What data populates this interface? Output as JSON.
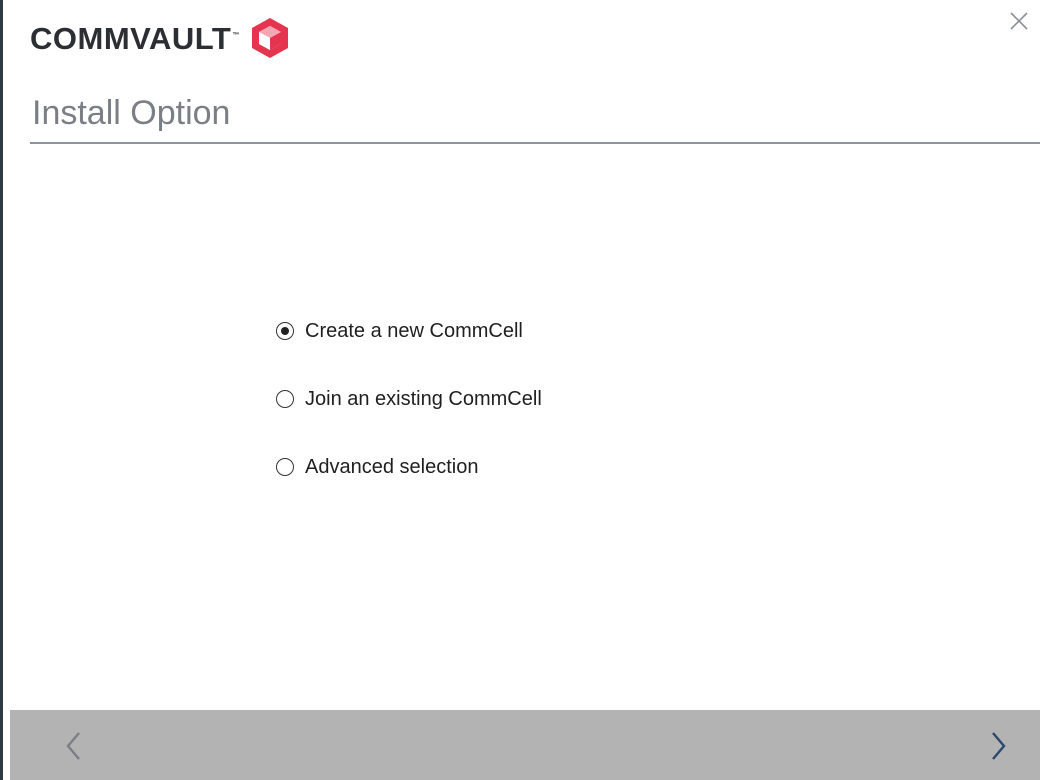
{
  "brand": {
    "name": "COMMVAULT",
    "tm": "™",
    "logo_color": "#e4344f"
  },
  "window": {
    "close_icon": "close-icon"
  },
  "page": {
    "title": "Install Option"
  },
  "options": [
    {
      "label": "Create a new CommCell",
      "selected": true
    },
    {
      "label": "Join an existing CommCell",
      "selected": false
    },
    {
      "label": "Advanced selection",
      "selected": false
    }
  ],
  "footer": {
    "back_icon": "chevron-left-icon",
    "next_icon": "chevron-right-icon",
    "back_color": "#7a7f86",
    "next_color": "#2b4a6b"
  }
}
